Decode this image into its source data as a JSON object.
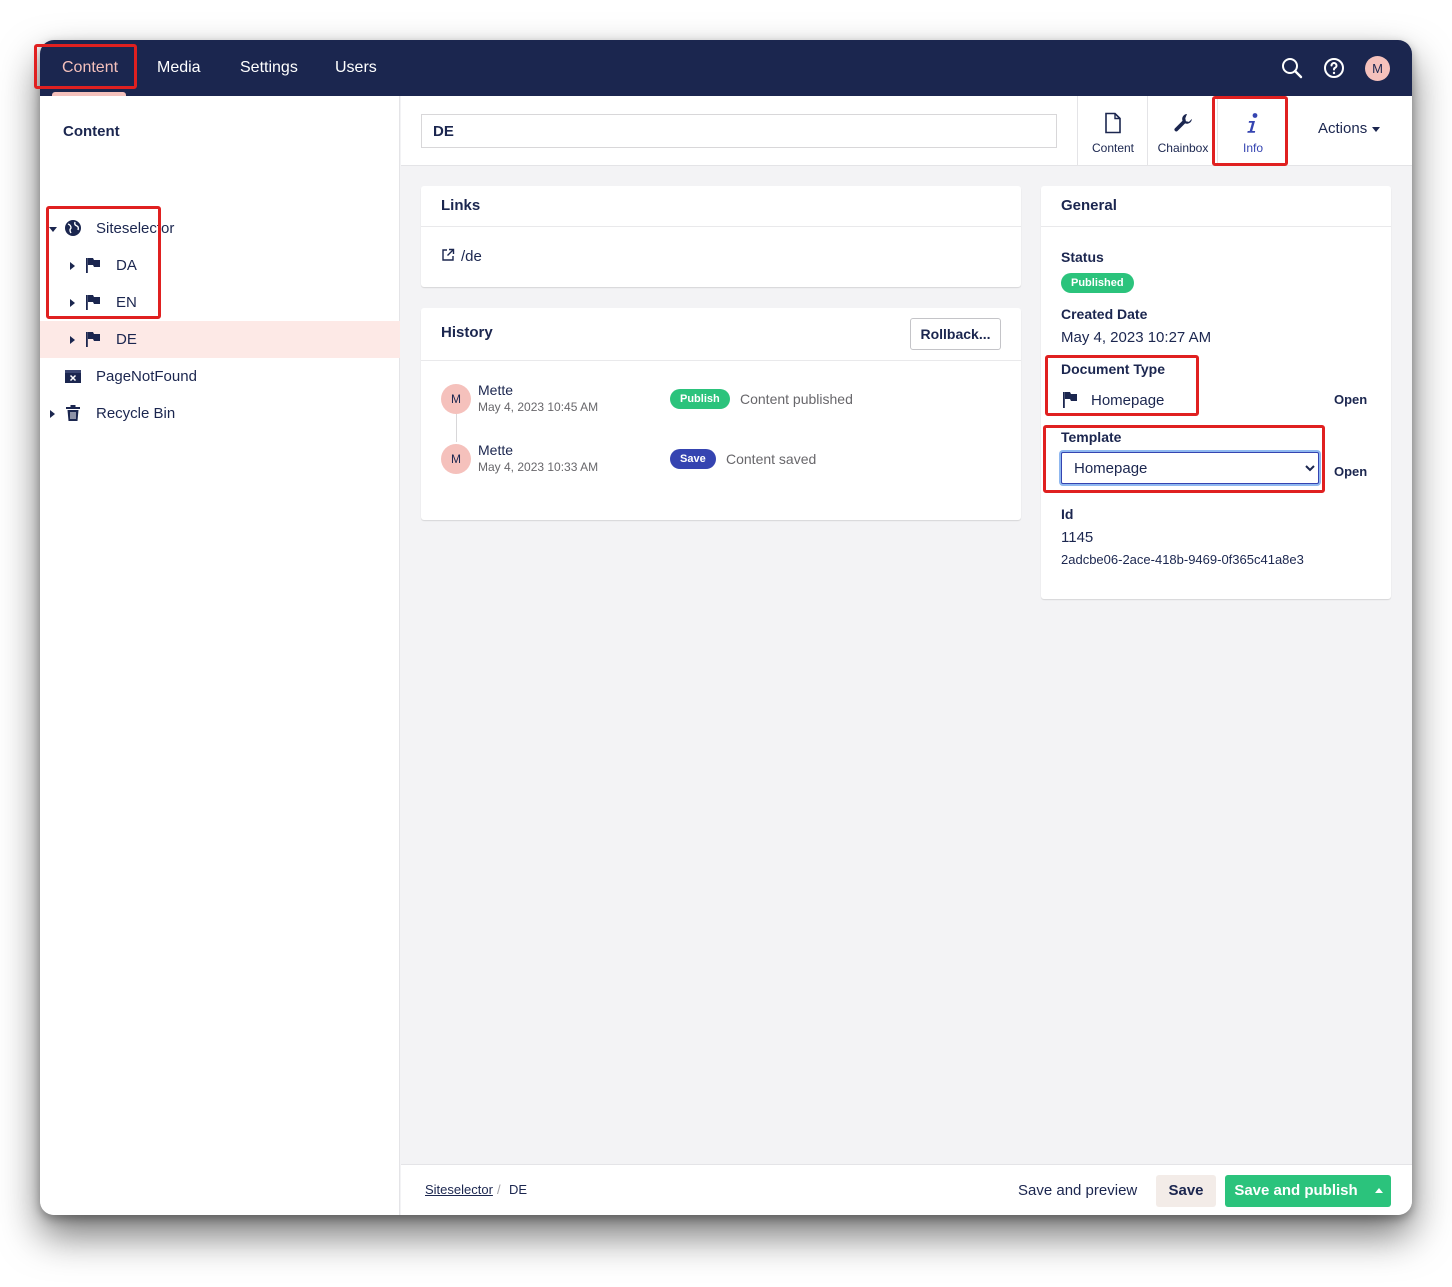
{
  "nav": {
    "items": [
      {
        "label": "Content",
        "active": true
      },
      {
        "label": "Media"
      },
      {
        "label": "Settings"
      },
      {
        "label": "Users"
      }
    ],
    "avatar_initial": "M",
    "icons": [
      "search-icon",
      "help-icon"
    ]
  },
  "sidebar": {
    "title": "Content",
    "tree": [
      {
        "label": "Siteselector",
        "icon": "globe-icon"
      },
      {
        "label": "DA",
        "icon": "flag-icon"
      },
      {
        "label": "EN",
        "icon": "flag-icon"
      },
      {
        "label": "DE",
        "icon": "flag-icon",
        "selected": true
      },
      {
        "label": "PageNotFound",
        "icon": "page-not-found-icon"
      },
      {
        "label": "Recycle Bin",
        "icon": "trash-icon"
      }
    ]
  },
  "header": {
    "name_value": "DE",
    "apps": [
      {
        "label": "Content",
        "icon": "document-icon"
      },
      {
        "label": "Chainbox",
        "icon": "wrench-icon"
      },
      {
        "label": "Info",
        "icon": "info-icon",
        "active": true
      }
    ],
    "actions_label": "Actions"
  },
  "links": {
    "title": "Links",
    "url": "/de"
  },
  "history": {
    "title": "History",
    "rollback_label": "Rollback...",
    "entries": [
      {
        "avatar": "M",
        "user": "Mette",
        "date": "May 4, 2023 10:45 AM",
        "badge": "Publish",
        "text": "Content published"
      },
      {
        "avatar": "M",
        "user": "Mette",
        "date": "May 4, 2023 10:33 AM",
        "badge": "Save",
        "text": "Content saved"
      }
    ]
  },
  "general": {
    "title": "General",
    "status_label": "Status",
    "status_value": "Published",
    "created_label": "Created Date",
    "created_value": "May 4, 2023 10:27 AM",
    "doctype_label": "Document Type",
    "doctype_value": "Homepage",
    "open_label": "Open",
    "template_label": "Template",
    "template_value": "Homepage",
    "id_label": "Id",
    "id_value": "1145",
    "guid_value": "2adcbe06-2ace-418b-9469-0f365c41a8e3"
  },
  "footer": {
    "crumb_parent": "Siteselector",
    "crumb_sep": "/",
    "crumb_current": "DE",
    "save_preview_label": "Save and preview",
    "save_label": "Save",
    "save_publish_label": "Save and publish"
  },
  "colors": {
    "topbar": "#1b264f",
    "accent_pink": "#f5c1bc",
    "publish_green": "#2bc37c",
    "save_blue": "#3544b1",
    "highlight_red": "#e02020"
  }
}
